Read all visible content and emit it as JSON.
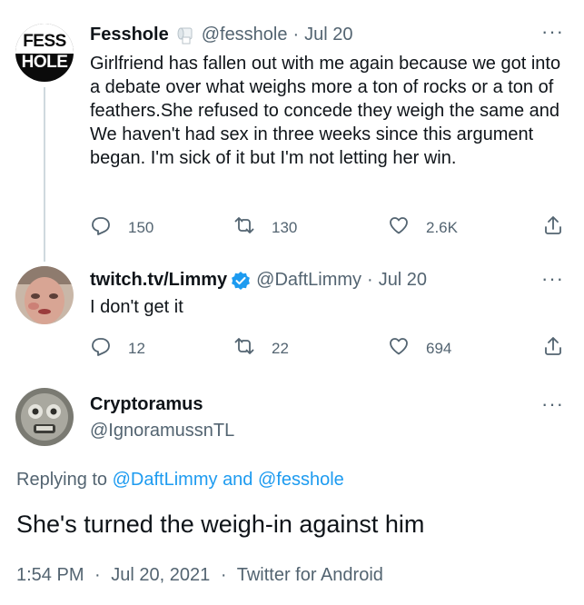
{
  "tweets": [
    {
      "avatar_text_top": "FESS",
      "avatar_text_bottom": "HOLE",
      "name": "Fesshole",
      "handle": "@fesshole",
      "date": "Jul 20",
      "text": "Girlfriend has fallen out with me again because we got into a debate over what weighs more a ton of rocks or a ton of feathers.She refused to concede they weigh the same and We haven't had sex in three weeks since this argument began. I'm sick of it but I'm not letting her win.",
      "replies": "150",
      "retweets": "130",
      "likes": "2.6K"
    },
    {
      "name": "twitch.tv/Limmy",
      "handle": "@DaftLimmy",
      "date": "Jul 20",
      "text": "I don't get it",
      "replies": "12",
      "retweets": "22",
      "likes": "694"
    }
  ],
  "focused": {
    "name": "Cryptoramus",
    "handle": "@IgnoramussnTL",
    "replying_prefix": "Replying to",
    "replying_user1": "@DaftLimmy",
    "replying_and": "and",
    "replying_user2": "@fesshole",
    "text": "She's turned the weigh-in against him",
    "time": "1:54 PM",
    "date": "Jul 20, 2021",
    "source": "Twitter for Android"
  },
  "more_glyph": "···",
  "dot_separator": "·",
  "colors": {
    "accent": "#1d9bf0",
    "secondary": "#536471",
    "line": "#cfd9de"
  },
  "icons": [
    "reply-icon",
    "retweet-icon",
    "like-icon",
    "share-icon",
    "verified-icon",
    "toilet-roll-icon",
    "more-icon"
  ]
}
